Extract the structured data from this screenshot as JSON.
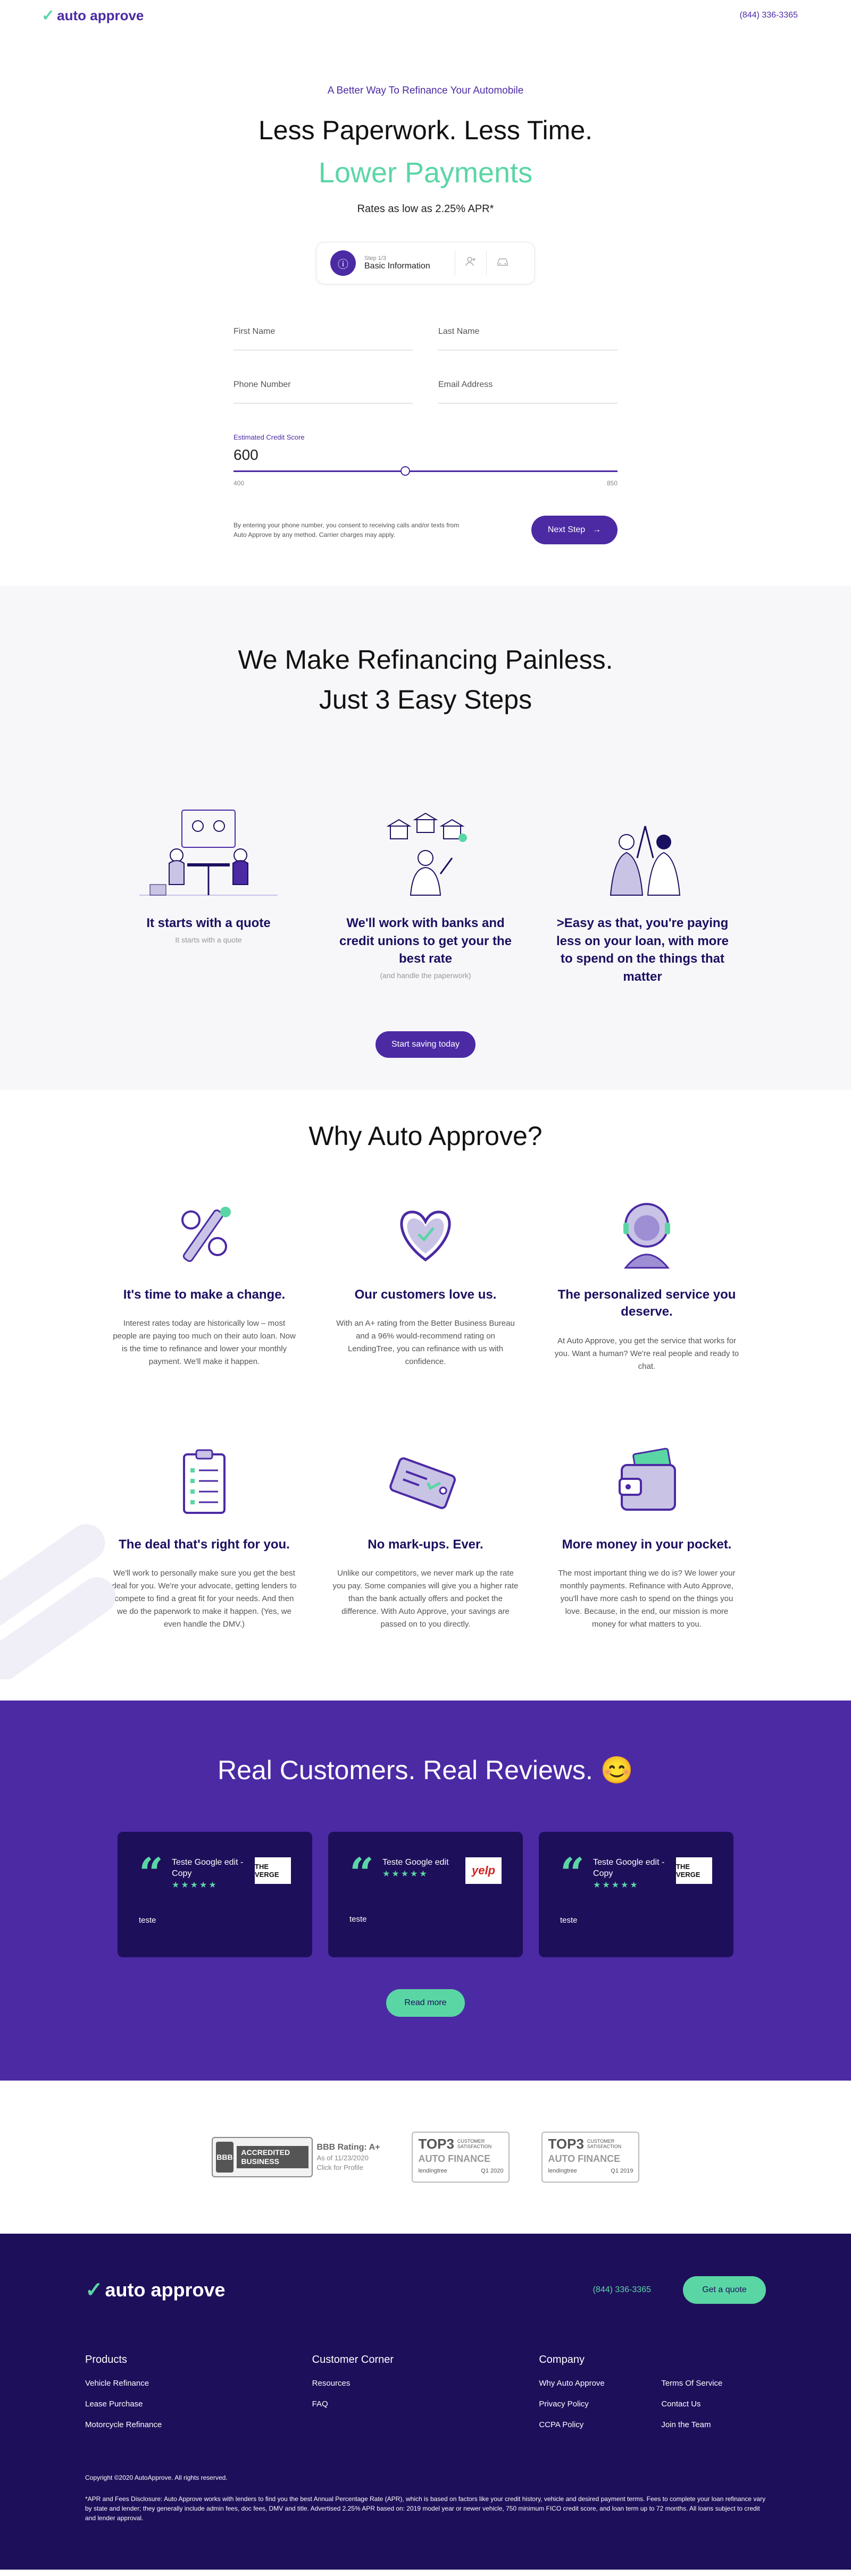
{
  "header": {
    "logo_text": "auto approve",
    "phone": "(844) 336-3365"
  },
  "hero": {
    "kicker": "A Better Way To Refinance Your Automobile",
    "title": "Less Paperwork. Less Time.",
    "subtitle": "Lower Payments",
    "rates": "Rates as low as 2.25% APR*"
  },
  "stepper": {
    "step_small": "Step 1/3",
    "step_label": "Basic Information",
    "icons": [
      "info-icon",
      "user-add-icon",
      "car-icon"
    ]
  },
  "form": {
    "first_name_placeholder": "First Name",
    "last_name_placeholder": "Last Name",
    "phone_placeholder": "Phone Number",
    "email_placeholder": "Email Address",
    "credit_label": "Estimated Credit Score",
    "credit_value": "600",
    "credit_min": "400",
    "credit_max": "850",
    "consent": "By entering your phone number, you consent to receiving calls and/or texts from Auto Approve by any method. Carrier charges may apply.",
    "next_label": "Next Step",
    "next_arrow": "→"
  },
  "easy": {
    "title_line1": "We Make Refinancing Painless.",
    "title_line2": "Just 3 Easy Steps",
    "steps": [
      {
        "title": "It starts with a quote",
        "sub": "It starts with a quote"
      },
      {
        "title": "We'll work with banks and credit unions to get your the best rate",
        "sub": "(and handle the paperwork)"
      },
      {
        "title": ">Easy as that, you're paying less on your loan, with more to spend on the things that matter",
        "sub": ""
      }
    ],
    "button": "Start saving today"
  },
  "why": {
    "title": "Why Auto Approve?",
    "items": [
      {
        "title": "It's time to make a change.",
        "text": "Interest rates today are historically low – most people are paying too much on their auto loan. Now is the time to refinance and lower your monthly payment. We'll make it happen."
      },
      {
        "title": "Our customers love us.",
        "text": "With an A+ rating from the Better Business Bureau and a 96% would-recommend rating on LendingTree, you can refinance with us with confidence."
      },
      {
        "title": "The personalized service you deserve.",
        "text": "At Auto Approve, you get the service that works for you. Want a human? We're real people and ready to chat."
      },
      {
        "title": "The deal that's right for you.",
        "text": "We'll work to personally make sure you get the best deal for you. We're your advocate, getting lenders to compete to find a great fit for your needs. And then we do the paperwork to make it happen. (Yes, we even handle the DMV.)"
      },
      {
        "title": "No mark-ups. Ever.",
        "text": "Unlike our competitors, we never mark up the rate you pay. Some companies will give you a higher rate than the bank actually offers and pocket the difference. With Auto Approve, your savings are passed on to you directly."
      },
      {
        "title": "More money in your pocket.",
        "text": "The most important thing we do is? We lower your monthly payments. Refinance with Auto Approve, you'll have more cash to spend on the things you love. Because, in the end, our mission is more money for what matters to you."
      }
    ]
  },
  "reviews": {
    "title": "Real Customers. Real Reviews.",
    "emoji": "😊",
    "cards": [
      {
        "author": "Teste Google edit - Copy",
        "stars": "★★★★★",
        "source": "THE VERGE",
        "text": "teste"
      },
      {
        "author": "Teste Google edit",
        "stars": "★★★★★",
        "source": "yelp",
        "text": "teste"
      },
      {
        "author": "Teste Google edit - Copy",
        "stars": "★★★★★",
        "source": "THE VERGE",
        "text": "teste"
      }
    ],
    "button": "Read more"
  },
  "badges": {
    "bbb_seal": "BBB",
    "bbb_accredited": "ACCREDITED BUSINESS",
    "bbb_rating": "BBB Rating: A+",
    "bbb_date": "As of 11/23/2020",
    "bbb_click": "Click for Profile",
    "top3_a": {
      "top": "TOP3",
      "sub": "CUSTOMER SATISFACTION",
      "af": "AUTO FINANCE",
      "brand": "lendingtree",
      "period": "Q1 2020"
    },
    "top3_b": {
      "top": "TOP3",
      "sub": "CUSTOMER SATISFACTION",
      "af": "AUTO FINANCE",
      "brand": "lendingtree",
      "period": "Q1 2019"
    }
  },
  "footer": {
    "logo_text": "auto approve",
    "phone": "(844) 336-3365",
    "quote_button": "Get a quote",
    "products_title": "Products",
    "products": [
      "Vehicle Refinance",
      "Lease Purchase",
      "Motorcycle Refinance"
    ],
    "corner_title": "Customer Corner",
    "corner": [
      "Resources",
      "FAQ"
    ],
    "company_title": "Company",
    "company": [
      "Why Auto Approve",
      "Privacy Policy",
      "CCPA Policy",
      "Terms Of Service",
      "Contact Us",
      "Join the Team"
    ],
    "copyright": "Copyright ©2020 AutoApprove. All rights reserved.",
    "disclosure": "*APR and Fees Disclosure: Auto Approve works with lenders to find you the best Annual Percentage Rate (APR), which is based on factors like your credit history, vehicle and desired payment terms. Fees to complete your loan refinance vary by state and lender; they generally include admin fees, doc fees, DMV and title. Advertised 2.25% APR based on: 2019 model year or newer vehicle, 750 minimum FICO credit score, and loan term up to 72 months. All loans subject to credit and lender approval."
  },
  "colors": {
    "brand": "#4b2aa4",
    "accent": "#5ad6a5",
    "dark": "#1e0f5a"
  }
}
